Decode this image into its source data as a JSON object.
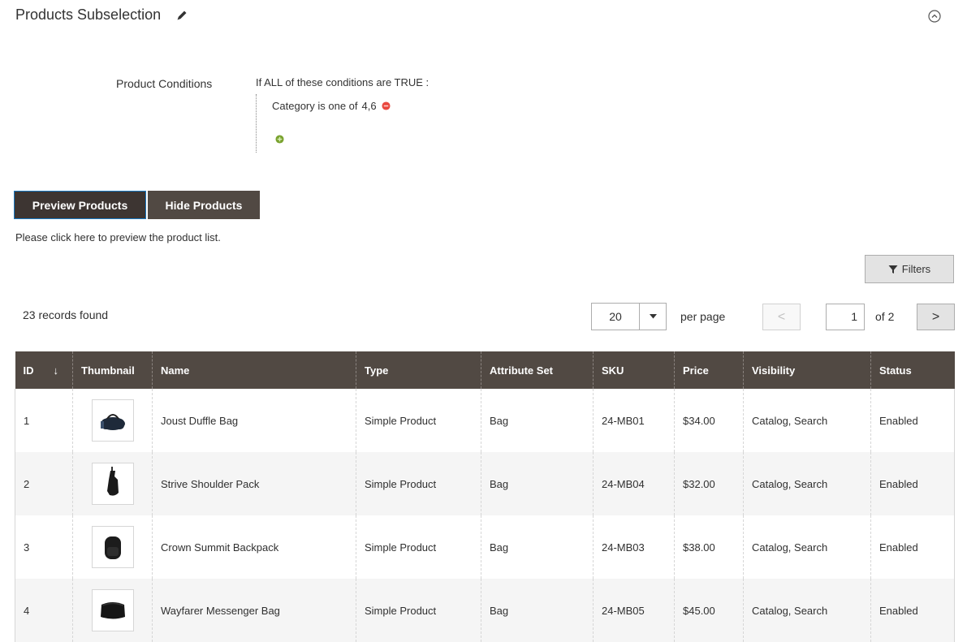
{
  "section": {
    "title": "Products Subselection"
  },
  "conditions": {
    "label": "Product Conditions",
    "head": "If ALL  of these conditions are TRUE :",
    "rule_text": "Category  is one of ",
    "rule_value": "4,6"
  },
  "buttons": {
    "preview": "Preview Products",
    "hide": "Hide Products",
    "filters": "Filters"
  },
  "preview_note": "Please click here to preview the product list.",
  "records_found": "23 records found",
  "pager": {
    "per_page_value": "20",
    "per_page_label": "per page",
    "current_page": "1",
    "of_pages": "of 2",
    "prev": "<",
    "next": ">"
  },
  "table": {
    "columns": [
      "ID",
      "Thumbnail",
      "Name",
      "Type",
      "Attribute Set",
      "SKU",
      "Price",
      "Visibility",
      "Status"
    ],
    "sort_arrow": "↓",
    "rows": [
      {
        "id": "1",
        "name": "Joust Duffle Bag",
        "type": "Simple Product",
        "attribute_set": "Bag",
        "sku": "24-MB01",
        "price": "$34.00",
        "visibility": "Catalog, Search",
        "status": "Enabled"
      },
      {
        "id": "2",
        "name": "Strive Shoulder Pack",
        "type": "Simple Product",
        "attribute_set": "Bag",
        "sku": "24-MB04",
        "price": "$32.00",
        "visibility": "Catalog, Search",
        "status": "Enabled"
      },
      {
        "id": "3",
        "name": "Crown Summit Backpack",
        "type": "Simple Product",
        "attribute_set": "Bag",
        "sku": "24-MB03",
        "price": "$38.00",
        "visibility": "Catalog, Search",
        "status": "Enabled"
      },
      {
        "id": "4",
        "name": "Wayfarer Messenger Bag",
        "type": "Simple Product",
        "attribute_set": "Bag",
        "sku": "24-MB05",
        "price": "$45.00",
        "visibility": "Catalog, Search",
        "status": "Enabled"
      }
    ]
  },
  "colors": {
    "header_bg": "#514943",
    "remove_icon": "#e9483f",
    "add_icon": "#79a22e"
  }
}
